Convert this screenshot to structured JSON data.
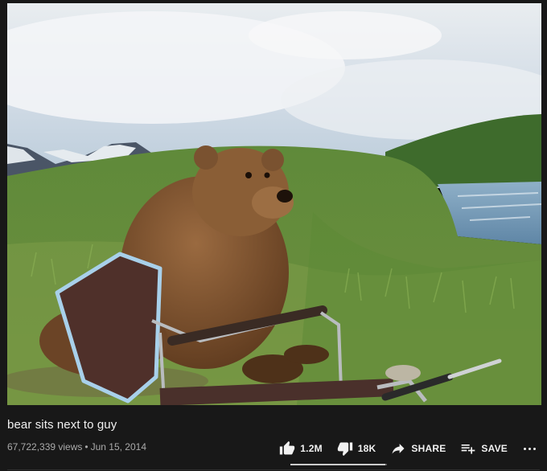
{
  "video": {
    "title": "bear sits next to guy",
    "views": "67,722,339 views",
    "separator": "•",
    "date": "Jun 15, 2014"
  },
  "actions": {
    "like_count": "1.2M",
    "dislike_count": "18K",
    "share_label": "SHARE",
    "save_label": "SAVE"
  },
  "sentiment": {
    "like_ratio": 0.985
  },
  "colors": {
    "page_bg": "#181818",
    "text_primary": "#f1f1f1",
    "text_secondary": "#aaaaaa"
  },
  "icons": {
    "like": "thumbs-up-icon",
    "dislike": "thumbs-down-icon",
    "share": "share-arrow-icon",
    "save": "playlist-add-icon",
    "more": "more-horizontal-icon"
  }
}
